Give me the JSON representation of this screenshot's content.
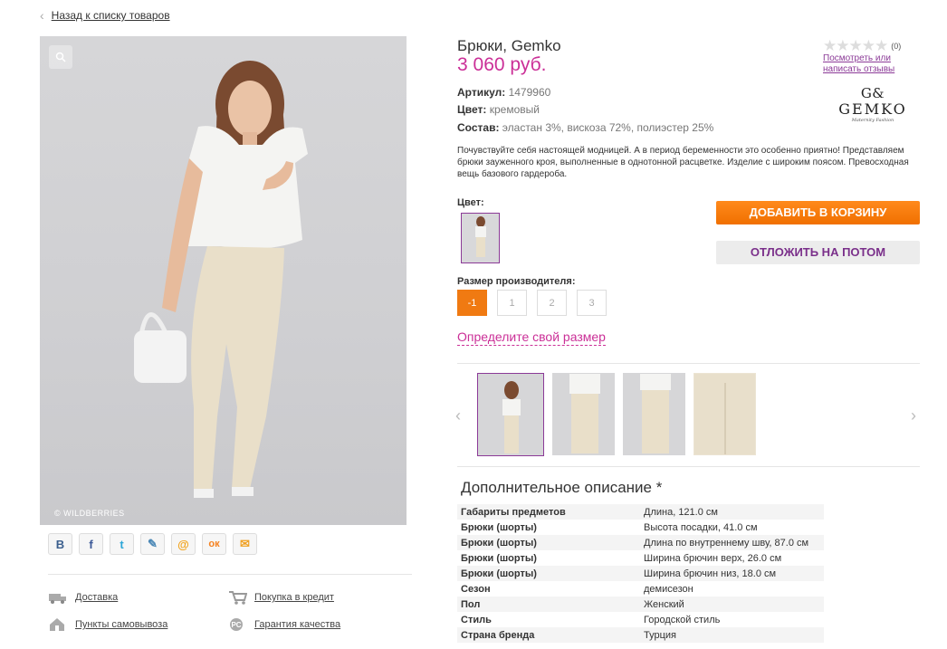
{
  "nav": {
    "back_label": "Назад к списку товаров"
  },
  "photo": {
    "watermark": "© WILDBERRIES"
  },
  "share": [
    {
      "label": "В",
      "icon": "vk-icon",
      "color": "#3b5f8e"
    },
    {
      "label": "f",
      "icon": "facebook-icon",
      "color": "#3b5998"
    },
    {
      "label": "t",
      "icon": "twitter-icon",
      "color": "#2ea7d8"
    },
    {
      "label": "✎",
      "icon": "livejournal-icon",
      "color": "#4b88b6"
    },
    {
      "label": "@",
      "icon": "mailru-icon",
      "color": "#f2a31b"
    },
    {
      "label": "ок",
      "icon": "odnoklassniki-icon",
      "color": "#f58220"
    },
    {
      "label": "✉",
      "icon": "email-icon",
      "color": "#f0a020"
    }
  ],
  "services": {
    "delivery": "Доставка",
    "credit": "Покупка в кредит",
    "pickup": "Пункты самовывоза",
    "quality": "Гарантия качества"
  },
  "product": {
    "title": "Брюки, Gemko",
    "price": "3 060 руб.",
    "article_label": "Артикул:",
    "article_value": "1479960",
    "color_label": "Цвет:",
    "color_value": "кремовый",
    "composition_label": "Состав:",
    "composition_value": "эластан 3%, вискоза 72%, полиэстер 25%",
    "description": "Почувствуйте себя настоящей модницей. А в период беременности это особенно приятно! Представляем брюки зауженного кроя, выполненные в однотонной расцветке. Изделие с широким поясом. Превосходная вещь базового гардероба."
  },
  "rating": {
    "count": "(0)",
    "reviews_link": "Посмотреть или написать отзывы"
  },
  "brand": {
    "name": "GEMKO",
    "tagline": "Maternity Fashion",
    "accent": "#cb2f97"
  },
  "color_section": {
    "label": "Цвет:"
  },
  "actions": {
    "add_to_cart": "ДОБАВИТЬ В КОРЗИНУ",
    "save_later": "ОТЛОЖИТЬ НА ПОТОМ"
  },
  "size_section": {
    "label": "Размер производителя:",
    "sizes": [
      "-1",
      "1",
      "2",
      "3"
    ],
    "selected": "-1",
    "size_link": "Определите свой размер"
  },
  "extra": {
    "title": "Дополнительное описание *",
    "rows": [
      {
        "k": "Габариты предметов",
        "v": "Длина, 121.0 см"
      },
      {
        "k": "Брюки (шорты)",
        "v": "Высота посадки, 41.0 см"
      },
      {
        "k": "Брюки (шорты)",
        "v": "Длина по внутреннему шву, 87.0 см"
      },
      {
        "k": "Брюки (шорты)",
        "v": "Ширина брючин верх, 26.0 см"
      },
      {
        "k": "Брюки (шорты)",
        "v": "Ширина брючин низ, 18.0 см"
      },
      {
        "k": "Сезон",
        "v": "демисезон"
      },
      {
        "k": "Пол",
        "v": "Женский"
      },
      {
        "k": "Стиль",
        "v": "Городской стиль"
      },
      {
        "k": "Страна бренда",
        "v": "Турция"
      }
    ]
  }
}
